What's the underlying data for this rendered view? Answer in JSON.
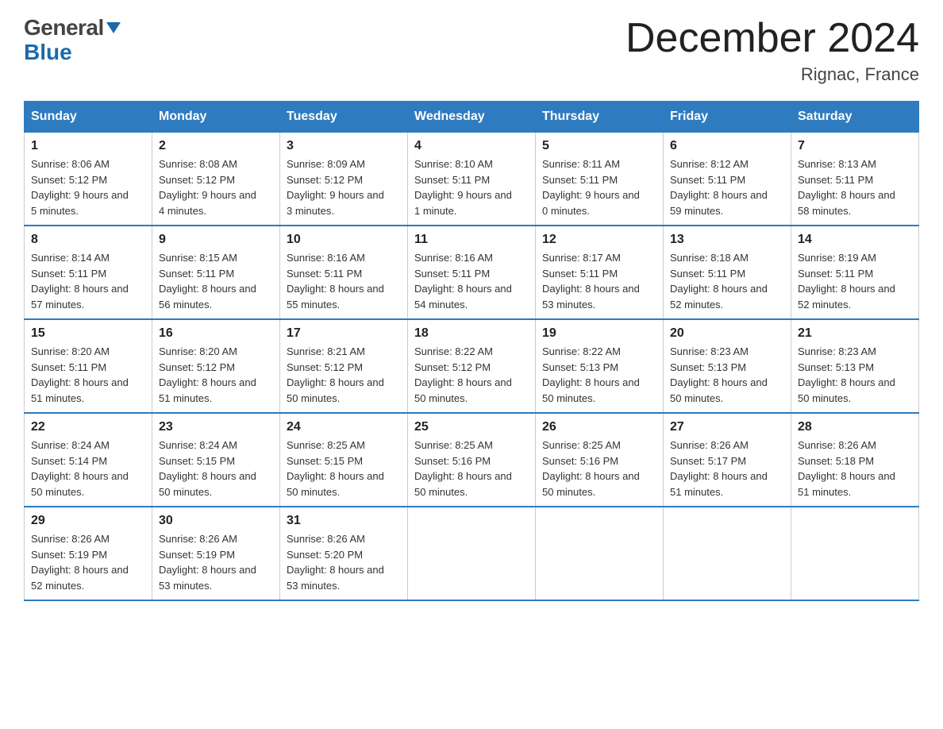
{
  "header": {
    "logo_line1": "General",
    "logo_arrow": "▶",
    "logo_line2": "Blue",
    "month_title": "December 2024",
    "location": "Rignac, France"
  },
  "days_of_week": [
    "Sunday",
    "Monday",
    "Tuesday",
    "Wednesday",
    "Thursday",
    "Friday",
    "Saturday"
  ],
  "weeks": [
    [
      {
        "day": "1",
        "sunrise": "8:06 AM",
        "sunset": "5:12 PM",
        "daylight": "9 hours and 5 minutes."
      },
      {
        "day": "2",
        "sunrise": "8:08 AM",
        "sunset": "5:12 PM",
        "daylight": "9 hours and 4 minutes."
      },
      {
        "day": "3",
        "sunrise": "8:09 AM",
        "sunset": "5:12 PM",
        "daylight": "9 hours and 3 minutes."
      },
      {
        "day": "4",
        "sunrise": "8:10 AM",
        "sunset": "5:11 PM",
        "daylight": "9 hours and 1 minute."
      },
      {
        "day": "5",
        "sunrise": "8:11 AM",
        "sunset": "5:11 PM",
        "daylight": "9 hours and 0 minutes."
      },
      {
        "day": "6",
        "sunrise": "8:12 AM",
        "sunset": "5:11 PM",
        "daylight": "8 hours and 59 minutes."
      },
      {
        "day": "7",
        "sunrise": "8:13 AM",
        "sunset": "5:11 PM",
        "daylight": "8 hours and 58 minutes."
      }
    ],
    [
      {
        "day": "8",
        "sunrise": "8:14 AM",
        "sunset": "5:11 PM",
        "daylight": "8 hours and 57 minutes."
      },
      {
        "day": "9",
        "sunrise": "8:15 AM",
        "sunset": "5:11 PM",
        "daylight": "8 hours and 56 minutes."
      },
      {
        "day": "10",
        "sunrise": "8:16 AM",
        "sunset": "5:11 PM",
        "daylight": "8 hours and 55 minutes."
      },
      {
        "day": "11",
        "sunrise": "8:16 AM",
        "sunset": "5:11 PM",
        "daylight": "8 hours and 54 minutes."
      },
      {
        "day": "12",
        "sunrise": "8:17 AM",
        "sunset": "5:11 PM",
        "daylight": "8 hours and 53 minutes."
      },
      {
        "day": "13",
        "sunrise": "8:18 AM",
        "sunset": "5:11 PM",
        "daylight": "8 hours and 52 minutes."
      },
      {
        "day": "14",
        "sunrise": "8:19 AM",
        "sunset": "5:11 PM",
        "daylight": "8 hours and 52 minutes."
      }
    ],
    [
      {
        "day": "15",
        "sunrise": "8:20 AM",
        "sunset": "5:11 PM",
        "daylight": "8 hours and 51 minutes."
      },
      {
        "day": "16",
        "sunrise": "8:20 AM",
        "sunset": "5:12 PM",
        "daylight": "8 hours and 51 minutes."
      },
      {
        "day": "17",
        "sunrise": "8:21 AM",
        "sunset": "5:12 PM",
        "daylight": "8 hours and 50 minutes."
      },
      {
        "day": "18",
        "sunrise": "8:22 AM",
        "sunset": "5:12 PM",
        "daylight": "8 hours and 50 minutes."
      },
      {
        "day": "19",
        "sunrise": "8:22 AM",
        "sunset": "5:13 PM",
        "daylight": "8 hours and 50 minutes."
      },
      {
        "day": "20",
        "sunrise": "8:23 AM",
        "sunset": "5:13 PM",
        "daylight": "8 hours and 50 minutes."
      },
      {
        "day": "21",
        "sunrise": "8:23 AM",
        "sunset": "5:13 PM",
        "daylight": "8 hours and 50 minutes."
      }
    ],
    [
      {
        "day": "22",
        "sunrise": "8:24 AM",
        "sunset": "5:14 PM",
        "daylight": "8 hours and 50 minutes."
      },
      {
        "day": "23",
        "sunrise": "8:24 AM",
        "sunset": "5:15 PM",
        "daylight": "8 hours and 50 minutes."
      },
      {
        "day": "24",
        "sunrise": "8:25 AM",
        "sunset": "5:15 PM",
        "daylight": "8 hours and 50 minutes."
      },
      {
        "day": "25",
        "sunrise": "8:25 AM",
        "sunset": "5:16 PM",
        "daylight": "8 hours and 50 minutes."
      },
      {
        "day": "26",
        "sunrise": "8:25 AM",
        "sunset": "5:16 PM",
        "daylight": "8 hours and 50 minutes."
      },
      {
        "day": "27",
        "sunrise": "8:26 AM",
        "sunset": "5:17 PM",
        "daylight": "8 hours and 51 minutes."
      },
      {
        "day": "28",
        "sunrise": "8:26 AM",
        "sunset": "5:18 PM",
        "daylight": "8 hours and 51 minutes."
      }
    ],
    [
      {
        "day": "29",
        "sunrise": "8:26 AM",
        "sunset": "5:19 PM",
        "daylight": "8 hours and 52 minutes."
      },
      {
        "day": "30",
        "sunrise": "8:26 AM",
        "sunset": "5:19 PM",
        "daylight": "8 hours and 53 minutes."
      },
      {
        "day": "31",
        "sunrise": "8:26 AM",
        "sunset": "5:20 PM",
        "daylight": "8 hours and 53 minutes."
      },
      null,
      null,
      null,
      null
    ]
  ],
  "labels": {
    "sunrise": "Sunrise:",
    "sunset": "Sunset:",
    "daylight": "Daylight:"
  }
}
